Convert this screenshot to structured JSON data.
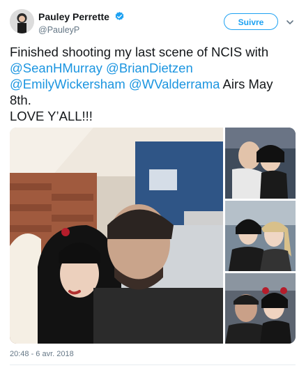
{
  "author": {
    "display_name": "Pauley Perrette",
    "handle": "@PauleyP",
    "verified": true
  },
  "follow_button_label": "Suivre",
  "tweet": {
    "text_line1": "Finished shooting my last scene of NCIS with ",
    "mention1": "@SeanHMurray",
    "mention2": "@BrianDietzen",
    "mention3": "@EmilyWickersham",
    "mention4": "@WValderrama",
    "text_after": " Airs May 8th.",
    "text_final": "LOVE Y’ALL!!!"
  },
  "timestamp": "20:48 - 6 avr. 2018",
  "colors": {
    "link": "#1b95e0",
    "follow": "#1da1f2",
    "verified": "#1da1f2",
    "meta": "#657786"
  },
  "icons": {
    "verified": "verified-badge-icon",
    "caret": "chevron-down-icon"
  }
}
